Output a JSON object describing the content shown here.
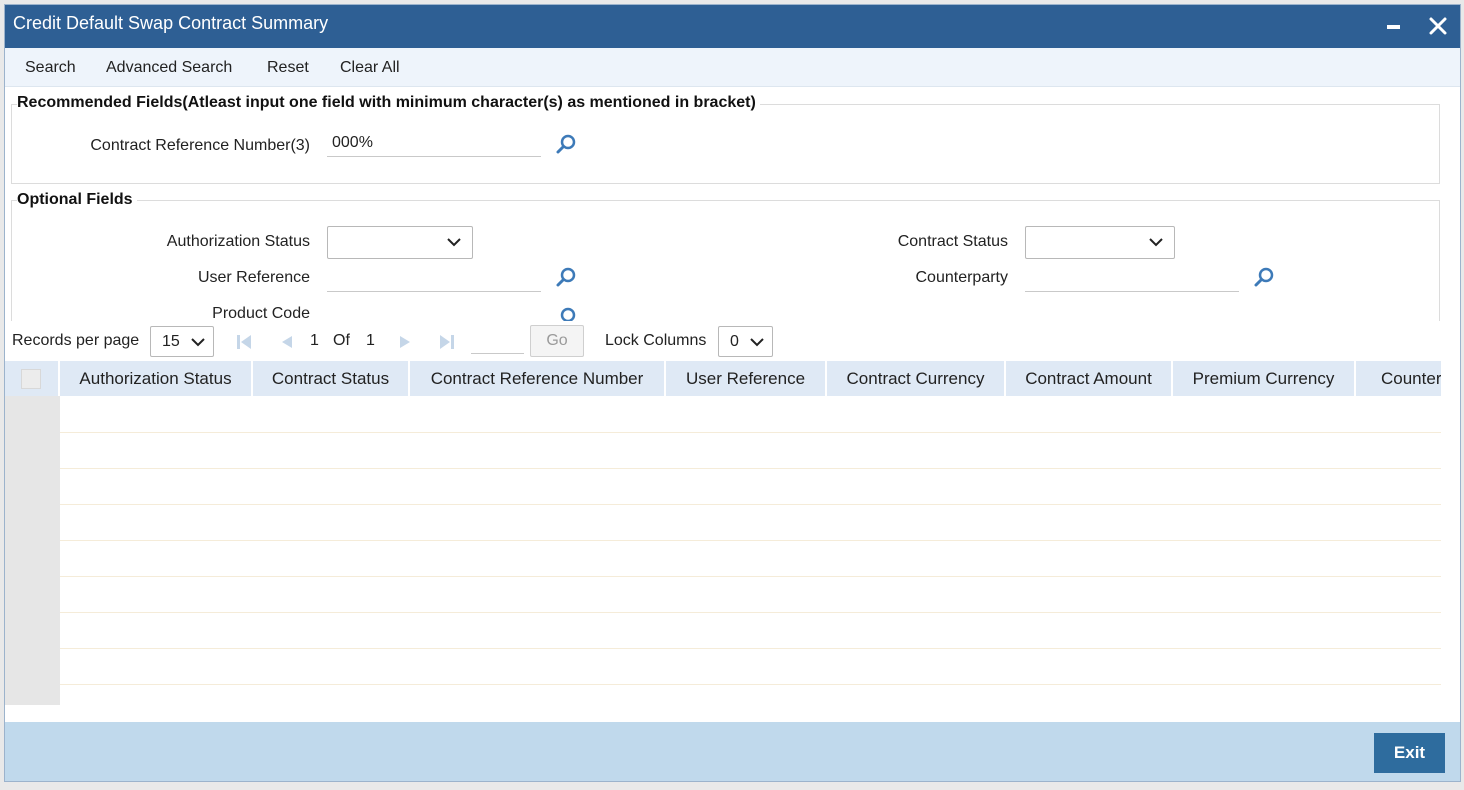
{
  "window": {
    "title": "Credit Default Swap Contract Summary"
  },
  "toolbar": {
    "search": "Search",
    "advanced_search": "Advanced Search",
    "reset": "Reset",
    "clear_all": "Clear All"
  },
  "recommended": {
    "title": "Recommended Fields(Atleast input one field with minimum character(s) as mentioned in bracket)",
    "contract_ref_label": "Contract Reference Number(3)",
    "contract_ref_value": "000%"
  },
  "optional": {
    "title": "Optional Fields",
    "auth_status_label": "Authorization Status",
    "contract_status_label": "Contract Status",
    "user_ref_label": "User Reference",
    "counterparty_label": "Counterparty",
    "product_code_label": "Product Code"
  },
  "pager": {
    "records_label": "Records per page",
    "records_value": "15",
    "current_page": "1",
    "of_label": "Of",
    "total_pages": "1",
    "go_label": "Go",
    "lock_label": "Lock Columns",
    "lock_value": "0"
  },
  "grid": {
    "columns": [
      "Authorization Status",
      "Contract Status",
      "Contract Reference Number",
      "User Reference",
      "Contract Currency",
      "Contract Amount",
      "Premium Currency",
      "Counter"
    ]
  },
  "footer": {
    "exit_label": "Exit"
  },
  "colors": {
    "title_bar": "#2e5f94",
    "header_bg": "#dfe9f5",
    "footer_bg": "#c0d9ec",
    "exit_btn": "#2e6c9e",
    "icon": "#3d7ab8"
  }
}
